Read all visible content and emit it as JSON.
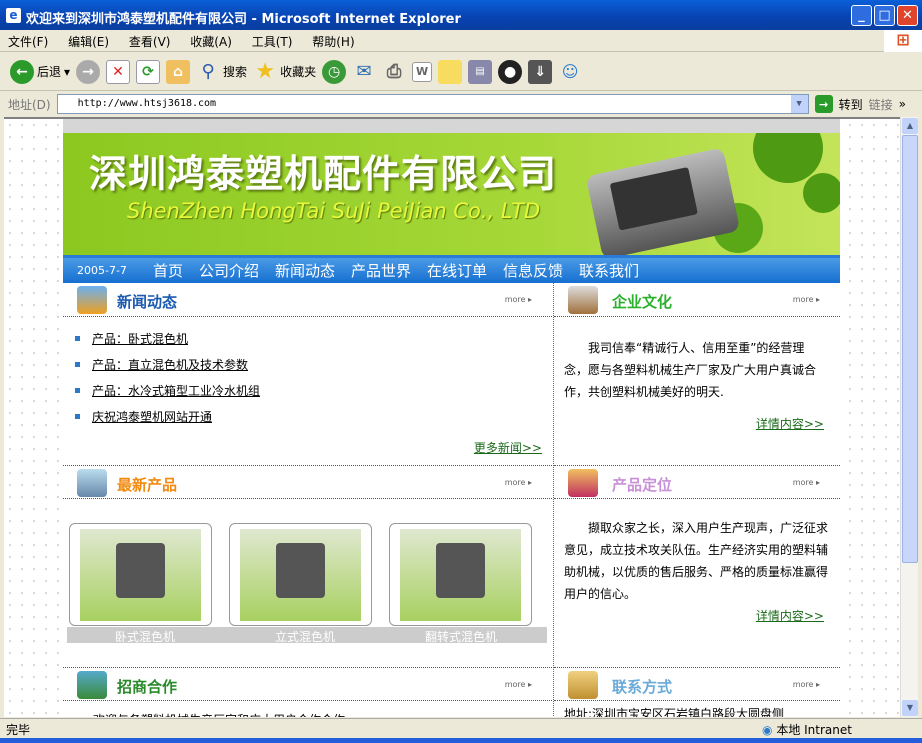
{
  "window": {
    "title": "欢迎来到深圳市鸿泰塑机配件有限公司 - Microsoft Internet Explorer"
  },
  "menu": [
    "文件(F)",
    "编辑(E)",
    "查看(V)",
    "收藏(A)",
    "工具(T)",
    "帮助(H)"
  ],
  "toolbar": {
    "back": "后退",
    "search": "搜索",
    "favorites": "收藏夹"
  },
  "address": {
    "label": "地址(D)",
    "url": "http://www.htsj3618.com",
    "go": "转到",
    "links": "链接"
  },
  "banner": {
    "title": "深圳鸿泰塑机配件有限公司",
    "subtitle": "ShenZhen HongTai SuJi PeiJian Co., LTD"
  },
  "nav": {
    "date": "2005-7-7",
    "items": [
      "首页",
      "公司介绍",
      "新闻动态",
      "产品世界",
      "在线订单",
      "信息反馈",
      "联系我们"
    ]
  },
  "news": {
    "title": "新闻动态",
    "more": "more",
    "items": [
      "产品：卧式混色机",
      "产品：直立混色机及技术参数",
      "产品：水冷式箱型工业冷水机组",
      "庆祝鸿泰塑机网站开通"
    ],
    "more_link": "更多新闻>>"
  },
  "culture": {
    "title": "企业文化",
    "more": "more",
    "text": "我司信奉“精诚行人、信用至重”的经营理念，愿与各塑料机械生产厂家及广大用户真诚合作，共创塑料机械美好的明天.",
    "detail": "详情内容>>"
  },
  "products": {
    "title": "最新产品",
    "more": "more",
    "items": [
      "卧式混色机",
      "立式混色机",
      "翻转式混色机"
    ]
  },
  "positioning": {
    "title": "产品定位",
    "more": "more",
    "text": "撷取众家之长，深入用户生产现声，广泛征求意见，成立技术攻关队伍。生产经济实用的塑料辅助机械，以优质的售后服务、严格的质量标准赢得用户的信心。",
    "detail": "详情内容>>"
  },
  "investment": {
    "title": "招商合作",
    "more": "more",
    "text": "欢迎与各塑料机械生产厂家和广大用户合作合作"
  },
  "contact": {
    "title": "联系方式",
    "more": "more",
    "address": "地址:深圳市宝安区石岩镇白路段大圆盘侧"
  },
  "status": {
    "text": "完毕",
    "zone": "本地 Intranet"
  }
}
